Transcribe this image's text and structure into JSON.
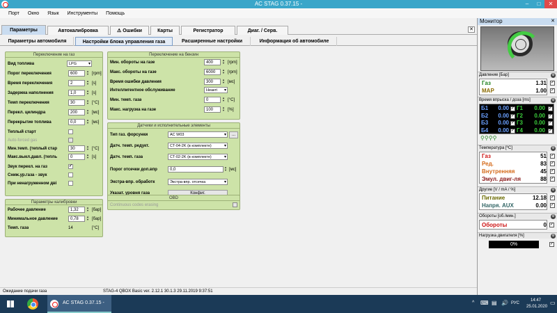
{
  "window": {
    "title": "AC STAG 0.37.15 -",
    "min": "–",
    "max": "□",
    "close": "✕"
  },
  "menu": [
    "Порт",
    "Окно",
    "Язык",
    "Инструменты",
    "Помощь"
  ],
  "tabs": [
    "Параметры",
    "Автокалибровка",
    "Ошибки",
    "Карты",
    "Регистратор",
    "Диаг. / Серв."
  ],
  "subtabs": [
    "Параметры автомобиля",
    "Настройки блока управления газа",
    "Расширенные настройки",
    "Информация об автомобиле"
  ],
  "p1": {
    "title": "Переключение на газ",
    "fuel_label": "Вид топлива",
    "fuel_value": "LPG",
    "fields": [
      {
        "label": "Порог переключения",
        "value": "600",
        "unit": "[rpm]"
      },
      {
        "label": "Время переключения",
        "value": "2",
        "unit": "[s]"
      },
      {
        "label": "Задержка наполнения",
        "value": "1,0",
        "unit": "[s]"
      },
      {
        "label": "Темп переключения",
        "value": "30",
        "unit": "[°C]"
      },
      {
        "label": "Перекл. цилиндра",
        "value": "200",
        "unit": "[мс]"
      },
      {
        "label": "Перекрытие топлива",
        "value": "0,0",
        "unit": "[мс]"
      }
    ],
    "warm_start": "Теплый старт",
    "auto_forced": "Auto-forced gas",
    "min_temp_label": "Мин.темп. (теплый стар",
    "min_temp_value": "30",
    "min_temp_unit": "[°C]",
    "min_exit_label": "Макс.выкл.давл. (тепль",
    "min_exit_value": "0",
    "min_exit_unit": "[s]",
    "checks": [
      "Звук перекл. на газ",
      "Сниж.ур.газа - звук",
      "При ненагруженном дві"
    ]
  },
  "p2": {
    "title": "Параметры калибровки",
    "fields": [
      {
        "label": "Рабочее давление",
        "value": "1,32",
        "unit": "[бар]"
      },
      {
        "label": "Минимальное давление",
        "value": "0,78",
        "unit": "[бар]"
      }
    ],
    "temp_label": "Темп. газа",
    "temp_value": "14",
    "temp_unit": "[°C]"
  },
  "p3": {
    "title": "Переключение на бензин",
    "fields": [
      {
        "label": "Мин. обороты на газе",
        "value": "400",
        "unit": "[rpm]"
      },
      {
        "label": "Макс. обороты на газе",
        "value": "6000",
        "unit": "[rpm]"
      },
      {
        "label": "Время ошибки давления",
        "value": "300",
        "unit": "[мс]"
      }
    ],
    "intel_label": "Интеллигентное обслуживание",
    "intel_value": "Неакті",
    "min_gas_label": "Мин. темп. газа",
    "min_gas_value": "0",
    "min_gas_unit": "[°C]",
    "max_load_label": "Макс. нагрузка на газе",
    "max_load_value": "100",
    "max_load_unit": "[%]"
  },
  "p4": {
    "title": "Датчики и исполнительные элементы",
    "injectors_label": "Тип газ. форсунки",
    "injectors_value": "AC W03",
    "dots": "...",
    "reducer_label": "Датч. темп. редукт.",
    "reducer_value": "CT-04-2K (в комплекте)",
    "gas_temp_label": "Датч. темп. газа",
    "gas_temp_value": "CT-02-2K (в комплекте)",
    "cutoff_label": "Порог отсечки доп.впр",
    "cutoff_value": "0,0",
    "cutoff_unit": "[мс]",
    "extra_label": "Экстра-впр. обработк",
    "extra_value": "Экстра-впр. отсечка",
    "level_label": "Указат. уровня газа",
    "config_button": "Конфиг."
  },
  "p5": {
    "title": "OBD",
    "text": "Continuous codes erasing"
  },
  "status": {
    "left": "Ожидание подачи газа",
    "right": "STAG-4 QBOX Basic  ver. 2.12.1  30.1.3   29.11.2019 9:37:51"
  },
  "monitor": {
    "title": "Монитор",
    "close": "✕",
    "pressure_header": "Давление [Бар]",
    "pressure": [
      {
        "label": "Газ",
        "value": "1.31",
        "color": "#1a7f1a"
      },
      {
        "label": "MAP",
        "value": "1.00",
        "color": "#8a6a00"
      }
    ],
    "inj_header": "Время впрыска / доза [ms]",
    "inj_b": [
      {
        "label": "Б1",
        "value": "0.00"
      },
      {
        "label": "Б2",
        "value": "0.00"
      },
      {
        "label": "Б3",
        "value": "0.00"
      },
      {
        "label": "Б4",
        "value": "0.00"
      }
    ],
    "inj_g": [
      {
        "label": "Г1",
        "value": "0.00"
      },
      {
        "label": "Г2",
        "value": "0.00"
      },
      {
        "label": "Г3",
        "value": "0.00"
      },
      {
        "label": "Г4",
        "value": "0.00"
      }
    ],
    "temp_header": "Температура [ºC]",
    "temps": [
      {
        "label": "Газ",
        "value": "51",
        "color": "#cc1111"
      },
      {
        "label": "Ред.",
        "value": "83",
        "color": "#d46a1a"
      },
      {
        "label": "Внутренняя",
        "value": "45",
        "color": "#d46a1a"
      },
      {
        "label": "Эмул. двиг-ля",
        "value": "88",
        "color": "#8a1a1a"
      }
    ],
    "other_header": "Другие [V / mA / %]",
    "others": [
      {
        "label": "Питание",
        "value": "12.18",
        "color": "#6a6a00"
      },
      {
        "label": "Напря. AUX",
        "value": "0.00",
        "color": "#336666"
      }
    ],
    "rpm_header": "Обороты [об./мин.]",
    "rpm_label": "Обороты",
    "rpm_value": "0",
    "load_header": "Нагрузка двигателя [%]",
    "load_value": "0%"
  },
  "taskbar": {
    "app": "AC STAG 0.37.15 -",
    "lang": "РУС",
    "time": "14:47",
    "date": "25.01.2020"
  }
}
